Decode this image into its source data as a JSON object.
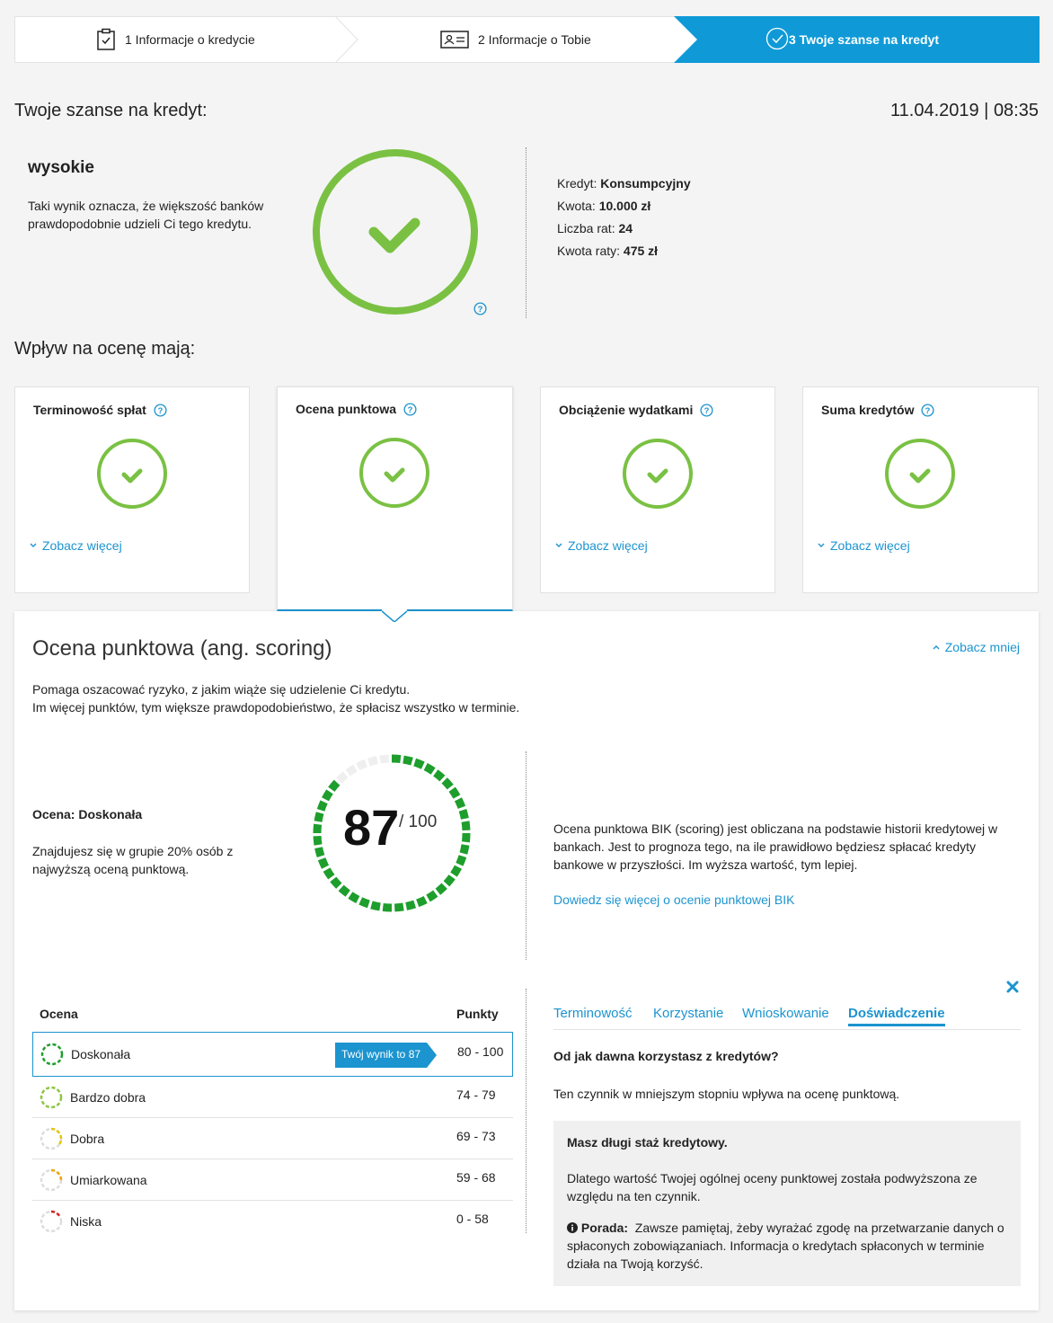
{
  "stepper": {
    "step1": "1 Informacje o kredycie",
    "step2": "2 Informacje o Tobie",
    "step3": "3 Twoje szanse na kredyt"
  },
  "summary": {
    "heading": "Twoje szanse na kredyt:",
    "datetime": "11.04.2019 | 08:35",
    "result": "wysokie",
    "result_desc_line1": "Taki wynik oznacza, że większość banków",
    "result_desc_line2": "prawdopodobnie udzieli Ci tego kredytu.",
    "details": [
      {
        "label": "Kredyt:",
        "value": "Konsumpcyjny"
      },
      {
        "label": "Kwota:",
        "value": "10.000 zł"
      },
      {
        "label": "Liczba rat:",
        "value": "24"
      },
      {
        "label": "Kwota raty:",
        "value": "475 zł"
      }
    ]
  },
  "factors": {
    "heading": "Wpływ na ocenę mają:",
    "cards": [
      {
        "title": "Terminowość spłat",
        "link": "Zobacz więcej"
      },
      {
        "title": "Ocena punktowa",
        "link": ""
      },
      {
        "title": "Obciążenie wydatkami",
        "link": "Zobacz więcej"
      },
      {
        "title": "Suma kredytów",
        "link": "Zobacz więcej"
      }
    ]
  },
  "detail": {
    "title": "Ocena punktowa (ang. scoring)",
    "collapse_link": "Zobacz mniej",
    "desc_line1": "Pomaga oszacować ryzyko, z jakim wiąże się udzielenie Ci kredytu.",
    "desc_line2": "Im więcej punktów, tym większe prawdopodobieństwo, że spłacisz wszystko w terminie.",
    "rating_label": "Ocena: Doskonała",
    "rating_desc_line1": "Znajdujesz się w grupie 20% osób z",
    "rating_desc_line2": "najwyższą oceną punktową.",
    "score": 87,
    "score_display": "87",
    "score_max": "/ 100",
    "bik_text_line1": "Ocena punktowa BIK (scoring) jest obliczana na podstawie historii kredytowej w",
    "bik_text_line2": "bankach. Jest to prognoza tego, na ile prawidłowo będziesz spłacać kredyty",
    "bik_text_line3": "bankowe w przyszłości. Im wyższa wartość, tym lepiej.",
    "bik_link": "Dowiedz się więcej o ocenie punktowej BIK"
  },
  "scale": {
    "col_rating": "Ocena",
    "col_points": "Punkty",
    "badge": "Twój wynik to 87",
    "rows": [
      {
        "name": "Doskonała",
        "points": "80 - 100",
        "color": "#1e9e2c"
      },
      {
        "name": "Bardzo dobra",
        "points": "74 - 79",
        "color": "#8cc63f"
      },
      {
        "name": "Dobra",
        "points": "69 - 73",
        "color": "#e5c700"
      },
      {
        "name": "Umiarkowana",
        "points": "59 - 68",
        "color": "#f0a500"
      },
      {
        "name": "Niska",
        "points": "0 - 58",
        "color": "#d6231e"
      }
    ]
  },
  "factor_tabs": {
    "tabs": [
      "Terminowość",
      "Korzystanie",
      "Wnioskowanie",
      "Doświadczenie"
    ],
    "active": "Doświadczenie",
    "question": "Od jak dawna korzystasz z kredytów?",
    "impact": "Ten czynnik w mniejszym stopniu wpływa na ocenę punktową.",
    "box_title": "Masz długi staż kredytowy.",
    "box_text_line1": "Dlatego wartość Twojej ogólnej oceny punktowej została podwyższona ze",
    "box_text_line2": "względu na ten czynnik.",
    "tip_label": "Porada:",
    "tip_line1": "Zawsze pamiętaj, żeby wyrażać zgodę na przetwarzanie danych o",
    "tip_line2": "spłaconych zobowiązaniach. Informacja o kredytach spłaconych w terminie",
    "tip_line3": "działa na Twoją korzyść."
  },
  "colors": {
    "accent": "#0f9ad7",
    "link": "#1c94cf",
    "success": "#7ac143",
    "score_green": "#1e9e2c"
  }
}
